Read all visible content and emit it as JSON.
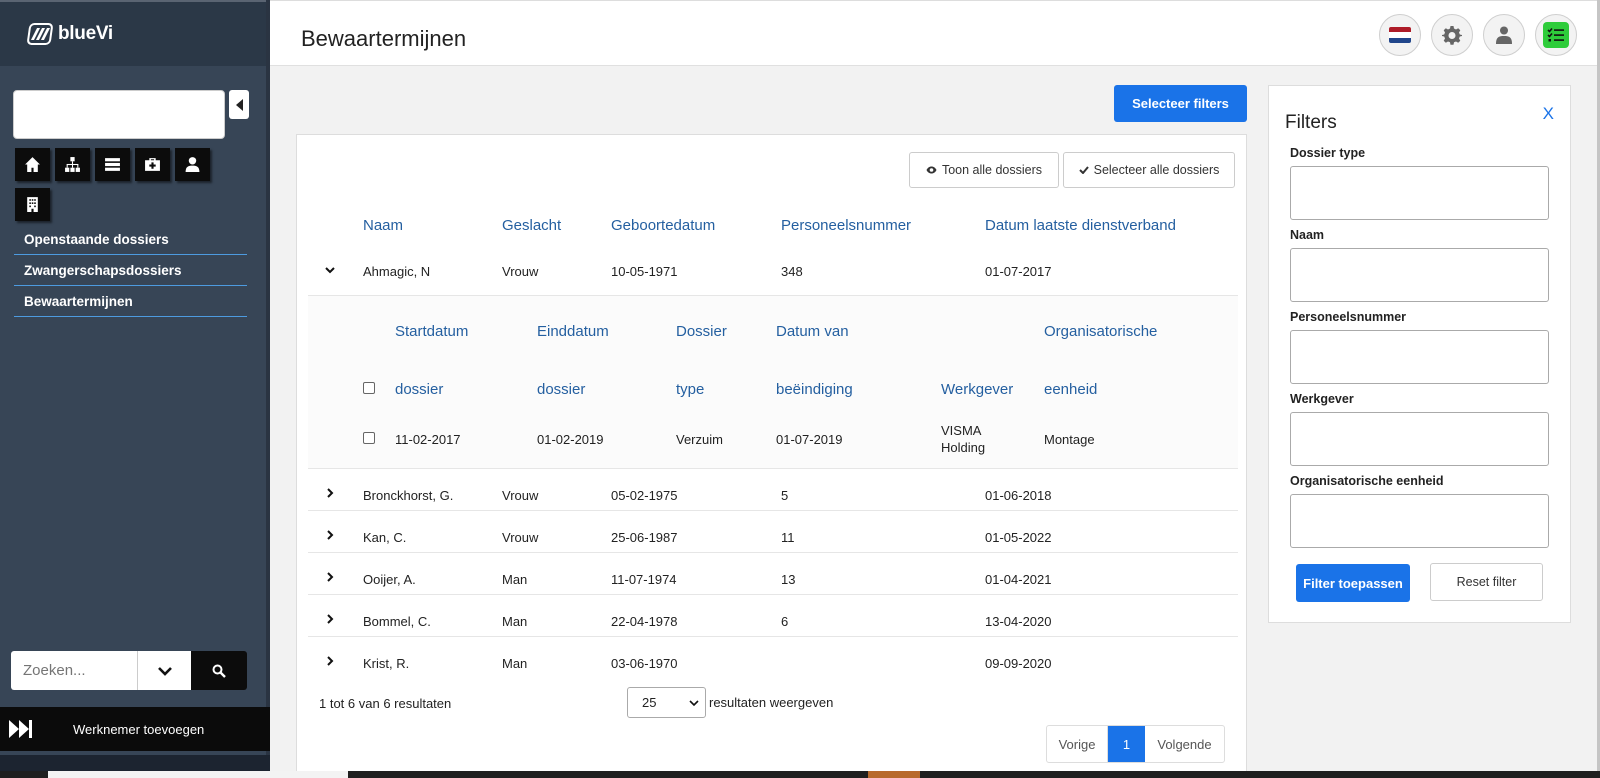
{
  "brand": {
    "name": "blueVi"
  },
  "sidebar": {
    "nav": [
      {
        "label": "Openstaande dossiers"
      },
      {
        "label": "Zwangerschapsdossiers"
      },
      {
        "label": "Bewaartermijnen"
      }
    ],
    "icons": [
      "home-icon",
      "org-chart-icon",
      "list-icon",
      "medical-case-icon",
      "user-icon",
      "building-icon"
    ],
    "search": {
      "placeholder": "Zoeken..."
    },
    "add_employee": "Werknemer toevoegen"
  },
  "header": {
    "title": "Bewaartermijnen",
    "icons": [
      "nl-flag-icon",
      "gear-icon",
      "user-icon",
      "checklist-icon"
    ]
  },
  "toolbar": {
    "select_filters": "Selecteer filters",
    "show_all": "Toon alle dossiers",
    "select_all": "Selecteer alle dossiers"
  },
  "table": {
    "columns": [
      "Naam",
      "Geslacht",
      "Geboortedatum",
      "Personeelsnummer",
      "Datum laatste dienstverband"
    ],
    "rows": [
      {
        "name": "Ahmagic, N",
        "gender": "Vrouw",
        "birth": "10-05-1971",
        "number": "348",
        "last": "01-07-2017",
        "expanded": true
      },
      {
        "name": "Bronckhorst, G.",
        "gender": "Vrouw",
        "birth": "05-02-1975",
        "number": "5",
        "last": "01-06-2018"
      },
      {
        "name": "Kan, C.",
        "gender": "Vrouw",
        "birth": "25-06-1987",
        "number": "11",
        "last": "01-05-2022"
      },
      {
        "name": "Ooijer, A.",
        "gender": "Man",
        "birth": "11-07-1974",
        "number": "13",
        "last": "01-04-2021"
      },
      {
        "name": "Bommel, C.",
        "gender": "Man",
        "birth": "22-04-1978",
        "number": "6",
        "last": "13-04-2020"
      },
      {
        "name": "Krist, R.",
        "gender": "Man",
        "birth": "03-06-1970",
        "number": "",
        "last": "09-09-2020"
      }
    ],
    "sub": {
      "columns_top": [
        "Startdatum",
        "Einddatum",
        "Dossier",
        "Datum van",
        "",
        "Organisatorische"
      ],
      "columns_bottom": [
        "dossier",
        "dossier",
        "type",
        "beëindiging",
        "Werkgever",
        "eenheid"
      ],
      "row": {
        "start": "11-02-2017",
        "end": "01-02-2019",
        "type": "Verzuim",
        "ended": "01-07-2019",
        "employer_1": "VISMA",
        "employer_2": "Holding",
        "unit": "Montage"
      }
    },
    "summary": "1 tot 6 van 6 resultaten",
    "page_size": "25",
    "page_size_suffix": "resultaten weergeven",
    "pager": {
      "prev": "Vorige",
      "current": "1",
      "next": "Volgende"
    }
  },
  "filters": {
    "title": "Filters",
    "close": "X",
    "fields": [
      "Dossier type",
      "Naam",
      "Personeelsnummer",
      "Werkgever",
      "Organisatorische eenheid"
    ],
    "apply": "Filter toepassen",
    "reset": "Reset filter"
  },
  "colors": {
    "accent": "#1a73e8",
    "sidebar": "#374556",
    "header_text": "#245fa0"
  }
}
